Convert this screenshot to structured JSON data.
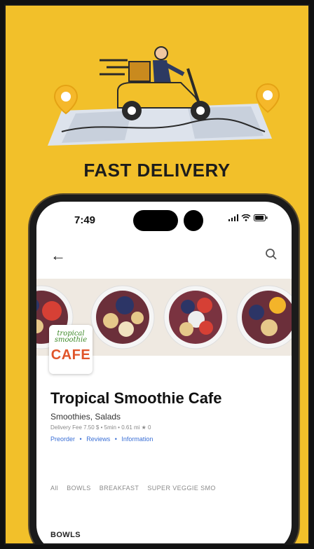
{
  "colors": {
    "background": "#f2c02a",
    "scooter": "#f2c02a",
    "pin": "#f5b82a",
    "link": "#3a6fd6",
    "logo_green": "#3f8a2a",
    "logo_orange": "#e0552a"
  },
  "headline": "FAST DELIVERY",
  "phone": {
    "status_time": "7:49",
    "status_icons": [
      "signal-icon",
      "wifi-icon",
      "battery-icon"
    ]
  },
  "restaurant": {
    "logo_top": "tropical smoothie",
    "logo_cafe": "CAFE",
    "name": "Tropical Smoothie Cafe",
    "cuisine": "Smoothies, Salads",
    "meta": "Delivery Fee 7.50 $ • 5min • 0.61 mi  ★ 0",
    "links": [
      "Preorder",
      "•",
      "Reviews",
      "•",
      "Information"
    ]
  },
  "tabs": [
    "All",
    "BOWLS",
    "BREAKFAST",
    "SUPER VEGGIE SMO"
  ],
  "section_title": "BOWLS"
}
